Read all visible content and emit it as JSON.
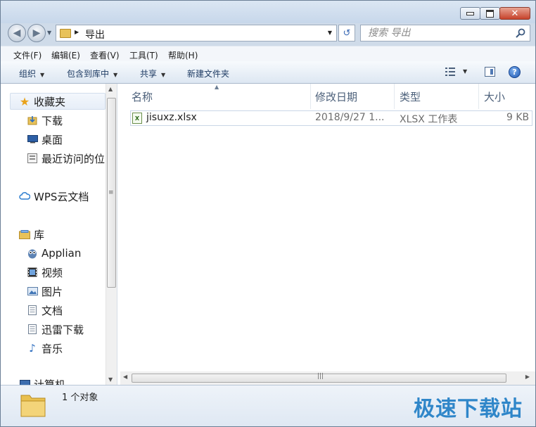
{
  "window": {
    "buttons": [
      "minimize",
      "maximize",
      "close"
    ]
  },
  "address": {
    "path": "导出",
    "search_placeholder": "搜索 导出"
  },
  "menu": [
    "文件(F)",
    "编辑(E)",
    "查看(V)",
    "工具(T)",
    "帮助(H)"
  ],
  "toolbar": {
    "organize": "组织",
    "include_library": "包含到库中",
    "share": "共享",
    "new_folder": "新建文件夹"
  },
  "nav": {
    "favorites": "收藏夹",
    "downloads": "下载",
    "desktop": "桌面",
    "recent": "最近访问的位",
    "wps": "WPS云文档",
    "libraries": "库",
    "applian": "Applian",
    "videos": "视频",
    "pictures": "图片",
    "documents": "文档",
    "thunder": "迅雷下载",
    "music": "音乐",
    "computer": "计算机"
  },
  "columns": {
    "name": "名称",
    "modified": "修改日期",
    "type": "类型",
    "size": "大小"
  },
  "files": [
    {
      "name": "jisuxz.xlsx",
      "modified": "2018/9/27 1...",
      "type": "XLSX 工作表",
      "size": "9 KB"
    }
  ],
  "status": {
    "count": "1 个对象"
  },
  "watermark": "极速下载站",
  "colors": {
    "accent": "#2f86c9",
    "frame": "#cfdbe9"
  }
}
